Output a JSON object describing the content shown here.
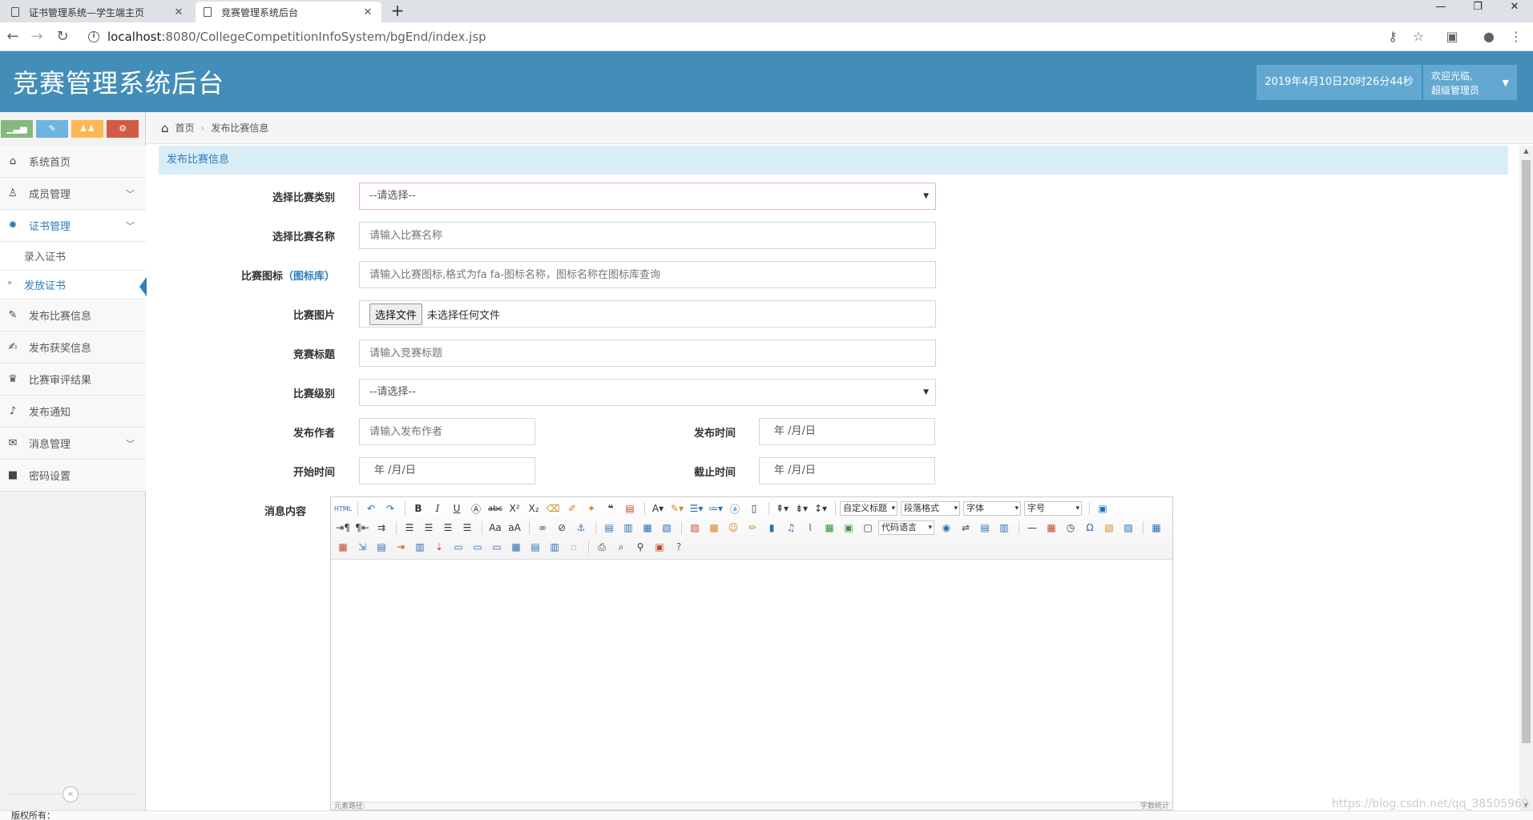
{
  "browser": {
    "tabs": [
      {
        "title": "证书管理系统—学生端主页",
        "close": "✕"
      },
      {
        "title": "竞赛管理系统后台",
        "close": "✕"
      }
    ],
    "new_tab": "+",
    "window": {
      "minimize": "—",
      "restore": "❐",
      "close": "✕"
    },
    "url_host": "localhost",
    "url_rest": ":8080/CollegeCompetitionInfoSystem/bgEnd/index.jsp"
  },
  "header": {
    "title": "竞赛管理系统后台",
    "datetime": "2019年4月10日20时26分44秒",
    "welcome": "欢迎光临,",
    "role": "超级管理员",
    "colors": {
      "bar": "#438eb9",
      "box": "#62a8d1"
    }
  },
  "sidebar": {
    "shortcut_colors": [
      "#87b87f",
      "#6fb3e0",
      "#ffb752",
      "#d15b47"
    ],
    "items": [
      {
        "label": "系统首页",
        "icon": "home-icon"
      },
      {
        "label": "成员管理",
        "icon": "users-icon"
      },
      {
        "label": "证书管理",
        "icon": "certificate-icon"
      },
      {
        "label": "发布比赛信息",
        "icon": "pencil-icon"
      },
      {
        "label": "发布获奖信息",
        "icon": "edit-icon"
      },
      {
        "label": "比赛审评结果",
        "icon": "trophy-icon"
      },
      {
        "label": "发布通知",
        "icon": "bell-icon"
      },
      {
        "label": "消息管理",
        "icon": "envelope-icon"
      },
      {
        "label": "密码设置",
        "icon": "lock-icon"
      }
    ],
    "subitems": [
      {
        "label": "录入证书"
      },
      {
        "label": "发放证书"
      }
    ]
  },
  "breadcrumb": {
    "home": "首页",
    "current": "发布比赛信息"
  },
  "page": {
    "header": "发布比赛信息"
  },
  "form": {
    "category": {
      "label": "选择比赛类别",
      "value": "--请选择--"
    },
    "name": {
      "label": "选择比赛名称",
      "placeholder": "请输入比赛名称"
    },
    "icon": {
      "label": "比赛图标",
      "link": "（图标库）",
      "placeholder": "请输入比赛图标,格式为fa fa-图标名称，图标名称在图标库查询"
    },
    "image": {
      "label": "比赛图片",
      "button": "选择文件",
      "status": "未选择任何文件"
    },
    "title": {
      "label": "竞赛标题",
      "placeholder": "请输入竞赛标题"
    },
    "level": {
      "label": "比赛级别",
      "value": "--请选择--"
    },
    "author": {
      "label": "发布作者",
      "placeholder": "请输入发布作者"
    },
    "publish_time": {
      "label": "发布时间",
      "value": "年 /月/日"
    },
    "start_time": {
      "label": "开始时间",
      "value": "年 /月/日"
    },
    "end_time": {
      "label": "截止时间",
      "value": "年 /月/日"
    },
    "content": {
      "label": "消息内容"
    }
  },
  "editor": {
    "combos": {
      "custom_title": "自定义标题",
      "paragraph": "段落格式",
      "font": "字体",
      "size": "字号",
      "code": "代码语言"
    },
    "status_left": "元素路径:",
    "status_right": "字数统计"
  },
  "footer": {
    "copyright": "版权所有："
  },
  "watermark": "https://blog.csdn.net/qq_38505969"
}
